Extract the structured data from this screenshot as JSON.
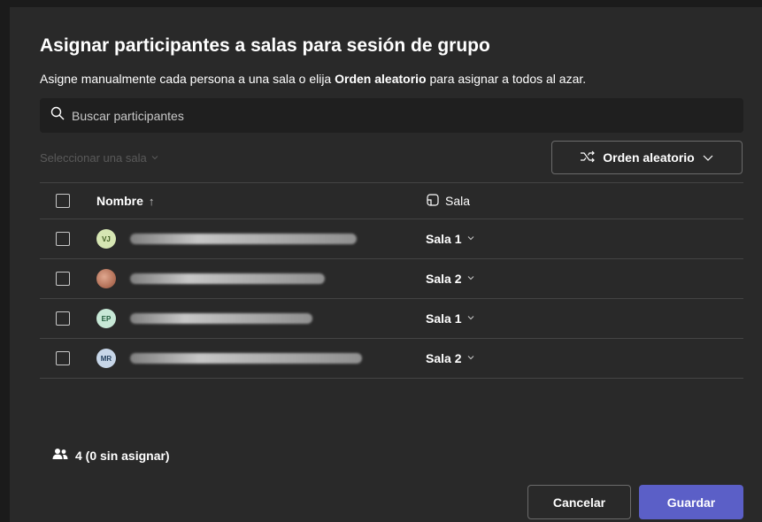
{
  "dialog": {
    "title": "Asignar participantes a salas para sesión de grupo",
    "subtitle_before": "Asigne manualmente cada persona a una sala o elija ",
    "subtitle_bold": "Orden aleatorio",
    "subtitle_after": " para asignar a todos al azar."
  },
  "search": {
    "placeholder": "Buscar participantes",
    "icon": "search-icon"
  },
  "room_select": {
    "label": "Seleccionar una sala",
    "icon": "chevron-down-icon"
  },
  "shuffle_button": {
    "label": "Orden aleatorio",
    "icon": "shuffle-icon"
  },
  "table": {
    "columns": {
      "name": "Nombre",
      "name_sort": "↑",
      "room": "Sala"
    },
    "rows": [
      {
        "initials": "VJ",
        "avatar_bg": "#d6e6b3",
        "avatar_fg": "#3d5a1f",
        "room": "Sala 1"
      },
      {
        "initials": "",
        "avatar_bg": "#c98a6e",
        "avatar_fg": "#ffffff",
        "room": "Sala 2"
      },
      {
        "initials": "EP",
        "avatar_bg": "#c7e8d6",
        "avatar_fg": "#1f5a3a",
        "room": "Sala 1"
      },
      {
        "initials": "MR",
        "avatar_bg": "#c7d6e8",
        "avatar_fg": "#26415f",
        "room": "Sala 2"
      }
    ]
  },
  "footer": {
    "count": "4 (0 sin asignar)",
    "cancel_label": "Cancelar",
    "save_label": "Guardar"
  },
  "colors": {
    "accent": "#5b5fc7",
    "dialog_bg": "#292929",
    "search_bg": "#1f1f1f"
  }
}
